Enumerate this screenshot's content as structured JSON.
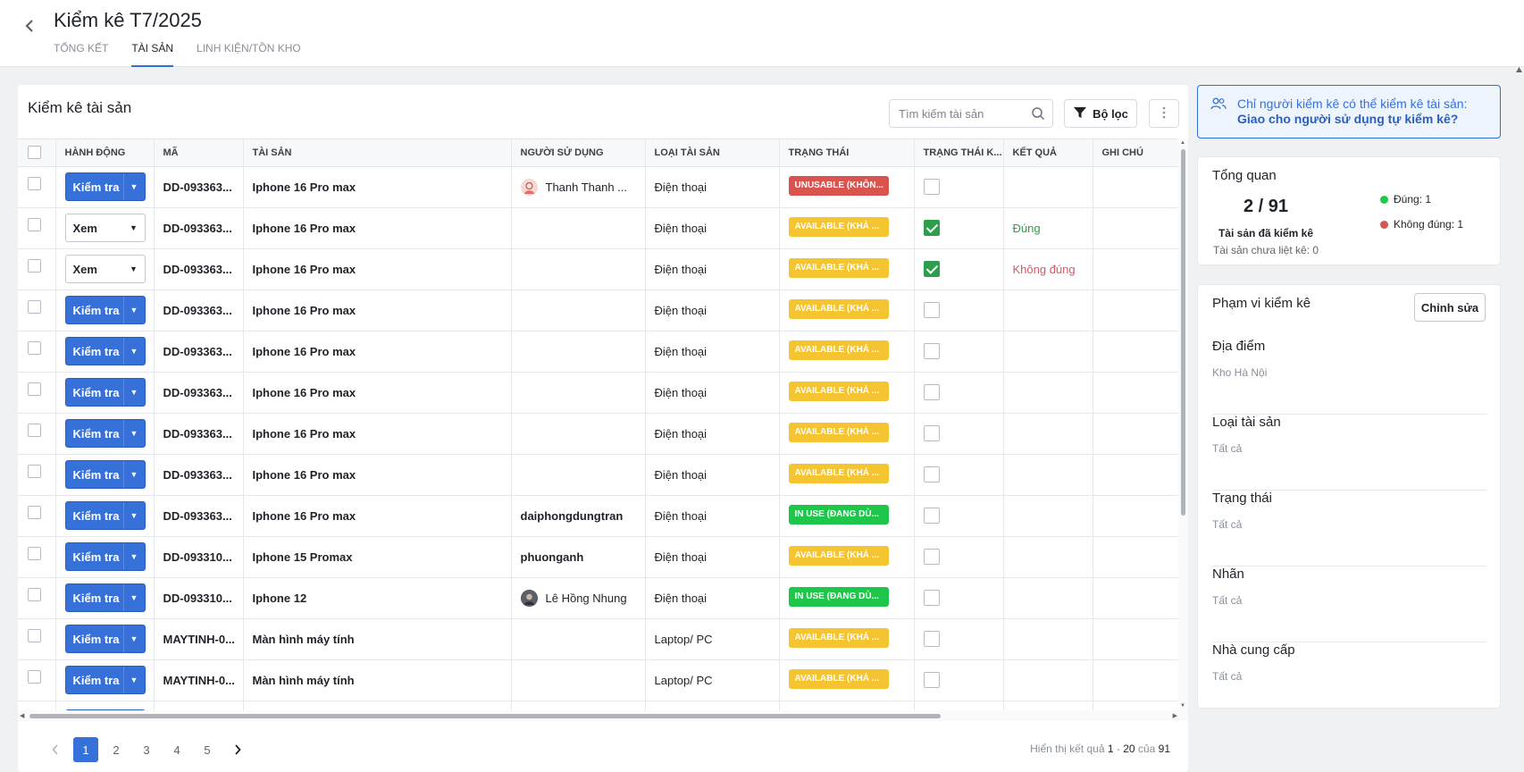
{
  "header": {
    "title": "Kiểm kê T7/2025",
    "tabs": [
      {
        "label": "TỔNG KẾT",
        "active": false
      },
      {
        "label": "TÀI SẢN",
        "active": true
      },
      {
        "label": "LINH KIỆN/TỒN KHO",
        "active": false
      }
    ]
  },
  "main": {
    "title": "Kiểm kê tài sản",
    "search_placeholder": "Tìm kiếm tài sản",
    "filter_label": "Bộ lọc",
    "columns": [
      "HÀNH ĐỘNG",
      "MÃ",
      "TÀI SẢN",
      "NGƯỜI SỬ DỤNG",
      "LOẠI TÀI SẢN",
      "TRẠNG THÁI",
      "TRẠNG THÁI K...",
      "KẾT QUẢ",
      "GHI CHÚ"
    ],
    "rows": [
      {
        "action": "Kiểm tra",
        "action_style": "primary",
        "code": "DD-093363...",
        "asset": "Iphone 16 Pro max",
        "user": "Thanh Thanh ...",
        "user_avatar": "girl",
        "type": "Điện thoại",
        "status": "UNUSABLE (KHÔN...",
        "status_color": "#d9534f",
        "checked": false,
        "result": "",
        "note": ""
      },
      {
        "action": "Xem",
        "action_style": "outline",
        "code": "DD-093363...",
        "asset": "Iphone 16 Pro max",
        "user": "",
        "user_avatar": "",
        "type": "Điện thoại",
        "status": "AVAILABLE (KHẢ ...",
        "status_color": "#f5c431",
        "checked": true,
        "result": "Đúng",
        "result_type": "ok",
        "note": ""
      },
      {
        "action": "Xem",
        "action_style": "outline",
        "code": "DD-093363...",
        "asset": "Iphone 16 Pro max",
        "user": "",
        "user_avatar": "",
        "type": "Điện thoại",
        "status": "AVAILABLE (KHẢ ...",
        "status_color": "#f5c431",
        "checked": true,
        "result": "Không đúng",
        "result_type": "bad",
        "note": ""
      },
      {
        "action": "Kiểm tra",
        "action_style": "primary",
        "code": "DD-093363...",
        "asset": "Iphone 16 Pro max",
        "user": "",
        "user_avatar": "",
        "type": "Điện thoại",
        "status": "AVAILABLE (KHẢ ...",
        "status_color": "#f5c431",
        "checked": false,
        "result": "",
        "note": ""
      },
      {
        "action": "Kiểm tra",
        "action_style": "primary",
        "code": "DD-093363...",
        "asset": "Iphone 16 Pro max",
        "user": "",
        "user_avatar": "",
        "type": "Điện thoại",
        "status": "AVAILABLE (KHẢ ...",
        "status_color": "#f5c431",
        "checked": false,
        "result": "",
        "note": ""
      },
      {
        "action": "Kiểm tra",
        "action_style": "primary",
        "code": "DD-093363...",
        "asset": "Iphone 16 Pro max",
        "user": "",
        "user_avatar": "",
        "type": "Điện thoại",
        "status": "AVAILABLE (KHẢ ...",
        "status_color": "#f5c431",
        "checked": false,
        "result": "",
        "note": ""
      },
      {
        "action": "Kiểm tra",
        "action_style": "primary",
        "code": "DD-093363...",
        "asset": "Iphone 16 Pro max",
        "user": "",
        "user_avatar": "",
        "type": "Điện thoại",
        "status": "AVAILABLE (KHẢ ...",
        "status_color": "#f5c431",
        "checked": false,
        "result": "",
        "note": ""
      },
      {
        "action": "Kiểm tra",
        "action_style": "primary",
        "code": "DD-093363...",
        "asset": "Iphone 16 Pro max",
        "user": "",
        "user_avatar": "",
        "type": "Điện thoại",
        "status": "AVAILABLE (KHẢ ...",
        "status_color": "#f5c431",
        "checked": false,
        "result": "",
        "note": ""
      },
      {
        "action": "Kiểm tra",
        "action_style": "primary",
        "code": "DD-093363...",
        "asset": "Iphone 16 Pro max",
        "user": "daiphongdungtran",
        "user_avatar": "",
        "type": "Điện thoại",
        "status": "IN USE (ĐANG DÙ...",
        "status_color": "#1ec74a",
        "checked": false,
        "result": "",
        "note": ""
      },
      {
        "action": "Kiểm tra",
        "action_style": "primary",
        "code": "DD-093310...",
        "asset": "Iphone 15 Promax",
        "user": "phuonganh",
        "user_avatar": "",
        "type": "Điện thoại",
        "status": "AVAILABLE (KHẢ ...",
        "status_color": "#f5c431",
        "checked": false,
        "result": "",
        "note": ""
      },
      {
        "action": "Kiểm tra",
        "action_style": "primary",
        "code": "DD-093310...",
        "asset": "Iphone 12",
        "user": "Lê Hồng Nhung",
        "user_avatar": "photo",
        "type": "Điện thoại",
        "status": "IN USE (ĐANG DÙ...",
        "status_color": "#1ec74a",
        "checked": false,
        "result": "",
        "note": ""
      },
      {
        "action": "Kiểm tra",
        "action_style": "primary",
        "code": "MAYTINH-0...",
        "asset": "Màn hình máy tính",
        "user": "",
        "user_avatar": "",
        "type": "Laptop/ PC",
        "status": "AVAILABLE (KHẢ ...",
        "status_color": "#f5c431",
        "checked": false,
        "result": "",
        "note": ""
      },
      {
        "action": "Kiểm tra",
        "action_style": "primary",
        "code": "MAYTINH-0...",
        "asset": "Màn hình máy tính",
        "user": "",
        "user_avatar": "",
        "type": "Laptop/ PC",
        "status": "AVAILABLE (KHẢ ...",
        "status_color": "#f5c431",
        "checked": false,
        "result": "",
        "note": ""
      }
    ],
    "pagination": {
      "pages": [
        "1",
        "2",
        "3",
        "4",
        "5"
      ],
      "active": "1",
      "info_prefix": "Hiển thị kết quả",
      "range_start": "1",
      "range_sep": "-",
      "range_end": "20",
      "of_label": "của",
      "total": "91"
    }
  },
  "sidebar": {
    "info_text": "Chỉ người kiểm kê có thể kiểm kê tài sản:",
    "info_link": "Giao cho người sử dụng tự kiểm kê?",
    "overview": {
      "title": "Tổng quan",
      "count": "2 / 91",
      "label_checked": "Tài sản đã kiểm kê",
      "label_unlisted": "Tài sản chưa liệt kê: 0",
      "legend_ok": "Đúng: 1",
      "legend_bad": "Không đúng: 1",
      "ok_color": "#1ec74a",
      "bad_color": "#d9534f"
    },
    "scope": {
      "title": "Phạm vi kiểm kê",
      "edit_label": "Chỉnh sửa",
      "fields": [
        {
          "label": "Địa điểm",
          "value": "Kho Hà Nội"
        },
        {
          "label": "Loại tài sản",
          "value": "Tất cả"
        },
        {
          "label": "Trạng thái",
          "value": "Tất cả"
        },
        {
          "label": "Nhãn",
          "value": "Tất cả"
        },
        {
          "label": "Nhà cung cấp",
          "value": "Tất cả"
        }
      ]
    }
  }
}
